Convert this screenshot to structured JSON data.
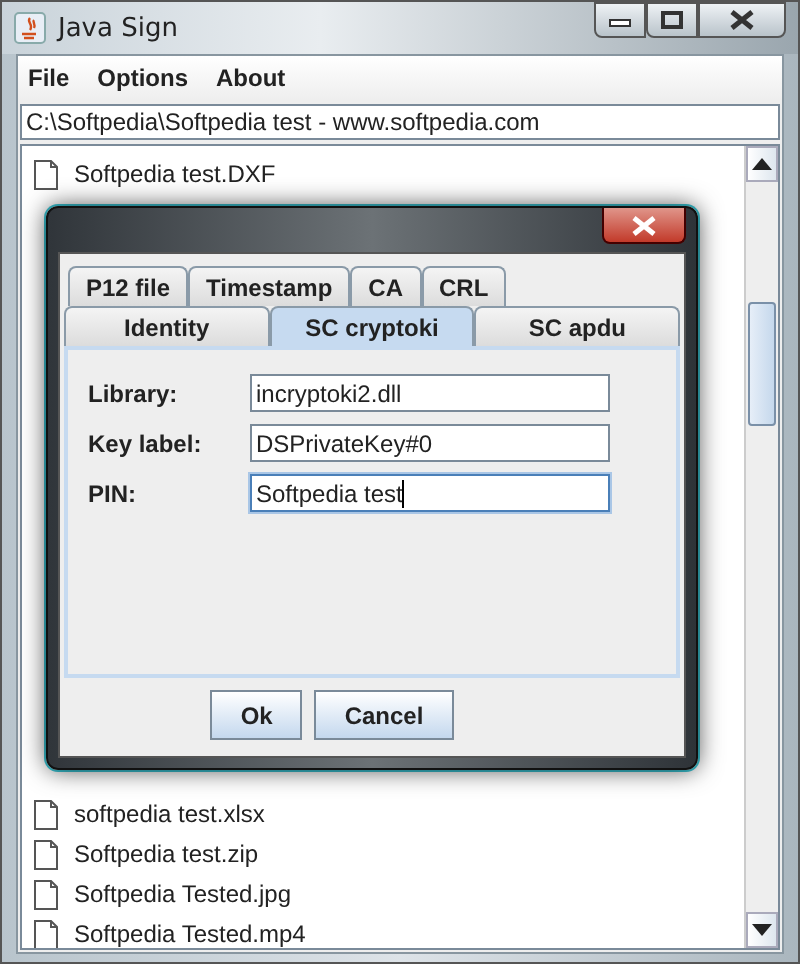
{
  "window": {
    "title": "Java Sign"
  },
  "menu": [
    "File",
    "Options",
    "About"
  ],
  "path": "C:\\Softpedia\\Softpedia test - www.softpedia.com",
  "files_above_dialog": [
    "Softpedia test.DXF"
  ],
  "files_below_dialog": [
    "softpedia test.xlsx",
    "Softpedia test.zip",
    "Softpedia Tested.jpg",
    "Softpedia Tested.mp4"
  ],
  "dialog": {
    "tab_rows": [
      [
        {
          "label": "P12 file",
          "selected": false
        },
        {
          "label": "Timestamp",
          "selected": false
        },
        {
          "label": "CA",
          "selected": false
        },
        {
          "label": "CRL",
          "selected": false
        }
      ],
      [
        {
          "label": "Identity",
          "selected": false
        },
        {
          "label": "SC cryptoki",
          "selected": true
        },
        {
          "label": "SC apdu",
          "selected": false
        }
      ]
    ],
    "fields": [
      {
        "label": "Library:",
        "value": "incryptoki2.dll",
        "focused": false
      },
      {
        "label": "Key label:",
        "value": "DSPrivateKey#0",
        "focused": false
      },
      {
        "label": "PIN:",
        "value": "Softpedia test",
        "focused": true
      }
    ],
    "buttons": [
      "Ok",
      "Cancel"
    ]
  }
}
